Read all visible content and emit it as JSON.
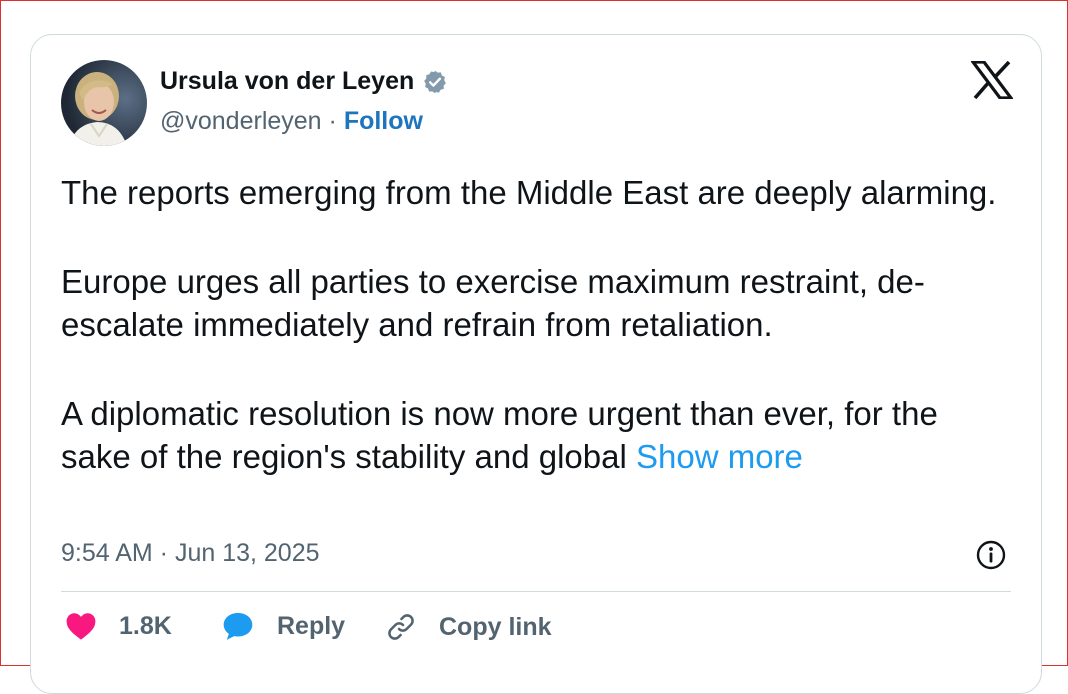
{
  "author": {
    "name": "Ursula von der Leyen",
    "handle": "@vonderleyen",
    "separator": " · ",
    "follow_label": "Follow",
    "avatar_icon": "profile-photo"
  },
  "tweet": {
    "paragraphs": [
      "The reports emerging from the Middle East are deeply alarming.",
      "Europe urges all parties to exercise maximum restraint, de-escalate immediately and refrain from retaliation.",
      "A diplomatic resolution is now more urgent than ever, for the sake of the region's stability and global "
    ],
    "show_more_label": "Show more"
  },
  "timestamp": "9:54 AM · Jun 13, 2025",
  "actions": {
    "like_count": "1.8K",
    "reply_label": "Reply",
    "copy_link_label": "Copy link"
  },
  "colors": {
    "like": "#f91880",
    "reply": "#1d9bf0",
    "link": "#1d9bf0",
    "follow": "#1d75bd",
    "verified": "#829aab",
    "frame_border": "#d9342b"
  }
}
